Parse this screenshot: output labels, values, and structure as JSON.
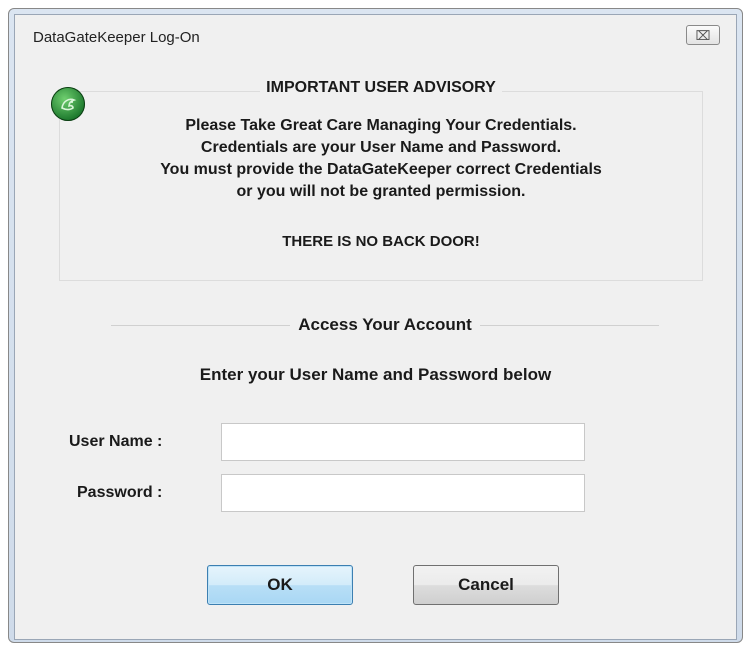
{
  "window": {
    "title": "DataGateKeeper Log-On",
    "close_glyph": "⌧"
  },
  "advisory": {
    "heading": "IMPORTANT USER ADVISORY",
    "logo_icon": "datagatekeeper-logo-icon",
    "lines": [
      "Please Take Great Care Managing Your Credentials.",
      "Credentials are your User Name and Password.",
      "You must provide the DataGateKeeper correct Credentials",
      "or you will not be granted permission."
    ],
    "warning": "THERE IS NO BACK DOOR!"
  },
  "account": {
    "section_title": "Access Your Account",
    "instruction": "Enter your User Name and Password below",
    "username_label": "User Name :",
    "username_value": "",
    "password_label": "Password :",
    "password_value": ""
  },
  "buttons": {
    "ok_label": "OK",
    "cancel_label": "Cancel"
  },
  "colors": {
    "window_bg": "#f0f0f0",
    "ok_border": "#3c7fb1",
    "logo_green": "#1e7a2e"
  }
}
